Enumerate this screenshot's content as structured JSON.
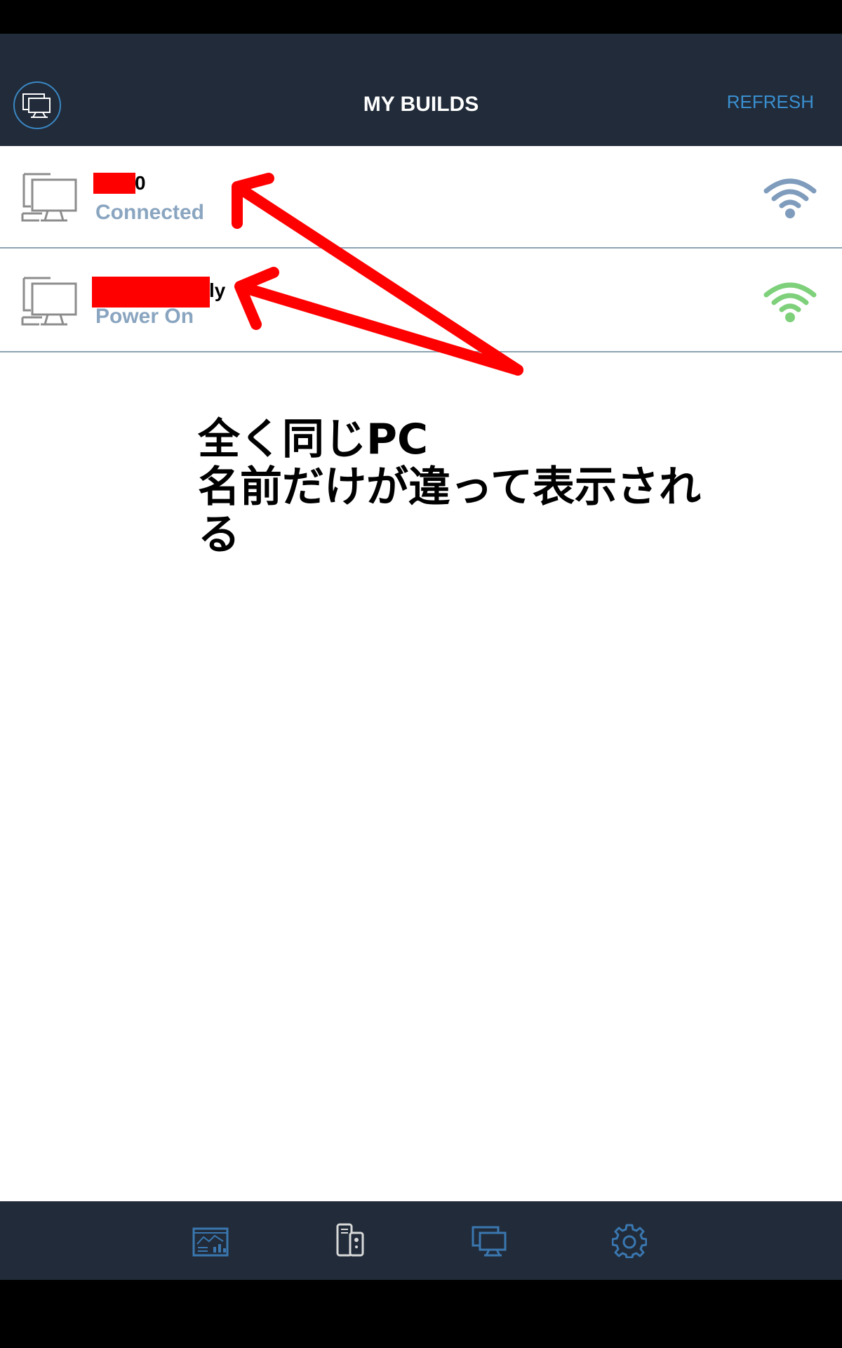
{
  "header": {
    "title": "MY BUILDS",
    "refresh_label": "REFRESH",
    "avatar_icon": "monitor-icon"
  },
  "builds": [
    {
      "name_suffix": "0",
      "status": "Connected",
      "wifi_color": "#7f9cbd",
      "icon": "desktop-pc-icon"
    },
    {
      "name_suffix": "ly",
      "status": "Power On",
      "wifi_color": "#7ed07a",
      "icon": "desktop-pc-icon"
    }
  ],
  "annotation": {
    "line1": "全く同じPC",
    "line2": "名前だけが違って表示され",
    "line3": "る"
  },
  "bottom_nav": [
    {
      "icon": "dashboard-icon",
      "active": false
    },
    {
      "icon": "pc-tower-icon",
      "active": true
    },
    {
      "icon": "monitor-icon",
      "active": false
    },
    {
      "icon": "gear-icon",
      "active": false
    }
  ],
  "colors": {
    "header_bg": "#212b39",
    "accent": "#3a8fd0",
    "status_text": "#8aa5c0",
    "arrow": "#ff0000"
  }
}
